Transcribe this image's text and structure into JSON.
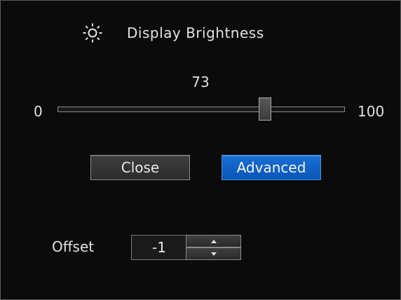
{
  "window": {
    "title": "Display Brightness",
    "title_icon": "sun-icon"
  },
  "brightness": {
    "value": 73,
    "value_label": "73",
    "min": 0,
    "max": 100,
    "min_label": "0",
    "max_label": "100"
  },
  "buttons": {
    "close_label": "Close",
    "advanced_label": "Advanced"
  },
  "offset": {
    "label": "Offset",
    "value": "-1",
    "up_icon": "triangle-up-icon",
    "down_icon": "triangle-down-icon"
  },
  "colors": {
    "background": "#0b0b0b",
    "accent": "#0a56b6",
    "text": "#e2e2e2"
  }
}
